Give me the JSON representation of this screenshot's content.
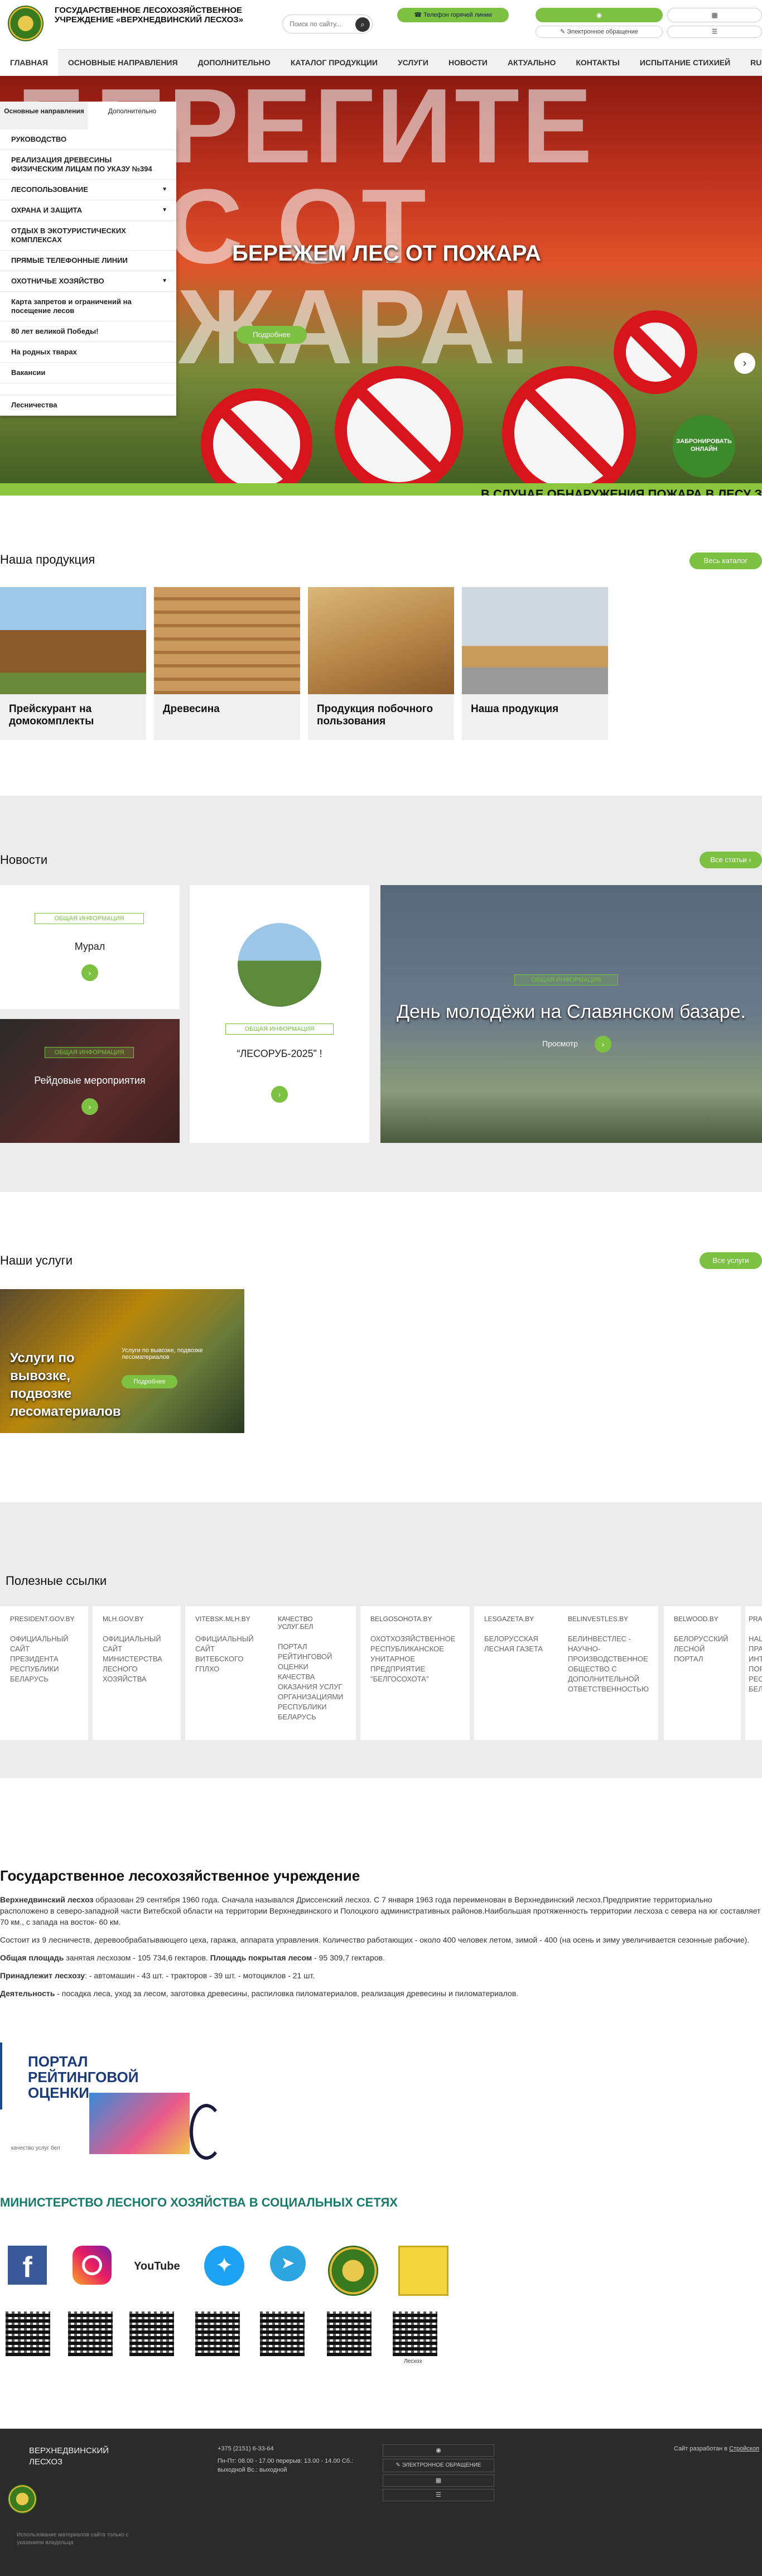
{
  "header": {
    "org_name": "ГОСУДАРСТВЕННОЕ ЛЕСОХОЗЯЙСТВЕННОЕ УЧРЕЖДЕНИЕ «ВЕРХНЕДВИНСКИЙ ЛЕСХОЗ»",
    "search_placeholder": "Поиск по сайту...",
    "hotline": "Телефон горячей линии",
    "eappeal": "Электронное обращение"
  },
  "nav": [
    "ГЛАВНАЯ",
    "ОСНОВНЫЕ НАПРАВЛЕНИЯ",
    "ДОПОЛНИТЕЛЬНО",
    "КАТАЛОГ ПРОДУКЦИИ",
    "УСЛУГИ",
    "НОВОСТИ",
    "АКТУАЛЬНО",
    "КОНТАКТЫ",
    "ИСПЫТАНИЕ СТИХИЕЙ",
    "RU"
  ],
  "dropdown": {
    "tabs": [
      "Основные направления",
      "Дополнительно"
    ],
    "items": [
      "РУКОВОДСТВО",
      "РЕАЛИЗАЦИЯ ДРЕВЕСИНЫ ФИЗИЧЕСКИМ ЛИЦАМ ПО УКАЗУ №394",
      "ЛЕСОПОЛЬЗОВАНИЕ",
      "ОХРАНА И ЗАЩИТА",
      "ОТДЫХ В ЭКОТУРИСТИЧЕСКИХ КОМПЛЕКСАХ",
      "ПРЯМЫЕ ТЕЛЕФОННЫЕ ЛИНИИ",
      "ОХОТНИЧЬЕ ХОЗЯЙСТВО",
      "Карта запретов и ограничений на посещение лесов",
      "80 лет великой Победы!",
      "На родных тварах",
      "Вакансии",
      "Лесничества"
    ]
  },
  "hero": {
    "big_text": "БЕРЕГИТЕ ЛЕС ОТ ПОЖАРА!",
    "title": "БЕРЕЖЕМ ЛЕС ОТ ПОЖАРА",
    "button": "Подробнее",
    "book": "ЗАБРОНИРОВАТЬ ОНЛАЙН",
    "ticker": "В СЛУЧАЕ ОБНАРУЖЕНИЯ ПОЖАРА В ЛЕСУ З"
  },
  "products": {
    "title": "Наша продукция",
    "button": "Весь каталог",
    "items": [
      "Прейскурант на домокомплекты",
      "Древесина",
      "Продукция побочного пользования",
      "Наша продукция"
    ]
  },
  "news": {
    "title": "Новости",
    "button": "Все статьи ›",
    "tag": "ОБЩАЯ ИНФОРМАЦИЯ",
    "items": [
      "Мурал",
      "Рейдовые мероприятия",
      "“ЛЕСОРУБ-2025” !",
      "День молодёжи на Славянском базаре."
    ],
    "view": "Просмотр"
  },
  "services": {
    "title": "Наши услуги",
    "button": "Все услуги",
    "card_title": "Услуги по вывозке, подвозке лесоматериалов",
    "card_small": "Услуги по вывозке, подвозке лесоматериалов",
    "card_btn": "Подробнее"
  },
  "links": {
    "title": "Полезные ссылки",
    "items": [
      {
        "dom": "PRESIDENT.GOV.BY",
        "desc": "ОФИЦИАЛЬНЫЙ САЙТ ПРЕЗИДЕНТА РЕСПУБЛИКИ БЕЛАРУСЬ"
      },
      {
        "dom": "MLH.GOV.BY",
        "desc": "ОФИЦИАЛЬНЫЙ САЙТ МИНИСТЕРСТВА ЛЕСНОГО ХОЗЯЙСТВА"
      },
      {
        "dom": "VITEBSK.MLH.BY",
        "desc": "ОФИЦИАЛЬНЫЙ САЙТ ВИТЕБСКОГО ГПЛХО"
      },
      {
        "dom": "КАЧЕСТВО УСЛУГ.БЕЛ",
        "desc": "ПОРТАЛ РЕЙТИНГОВОЙ ОЦЕНКИ КАЧЕСТВА ОКАЗАНИЯ УСЛУГ ОРГАНИЗАЦИЯМИ РЕСПУБЛИКИ БЕЛАРУСЬ"
      },
      {
        "dom": "BELGOSOHOTA.BY",
        "desc": "ОХОТХОЗЯЙСТВЕННОЕ РЕСПУБЛИКАНСКОЕ УНИТАРНОЕ ПРЕДПРИЯТИЕ \"БЕЛГОСОХОТА\""
      },
      {
        "dom": "LESGAZETA.BY",
        "desc": "БЕЛОРУССКАЯ ЛЕСНАЯ ГАЗЕТА"
      },
      {
        "dom": "BELINVESTLES.BY",
        "desc": "БЕЛИНВЕСТЛЕС - НАУЧНО-ПРОИЗВОДСТВЕННОЕ ОБЩЕСТВО С ДОПОЛНИТЕЛЬНОЙ ОТВЕТСТВЕННОСТЬЮ"
      },
      {
        "dom": "BELWOOD.BY",
        "desc": "БЕЛОРУССКИЙ ЛЕСНОЙ ПОРТАЛ"
      },
      {
        "dom": "PRAVO.BY",
        "desc": "НАЦИОНАЛЬНЫЙ ПРАВОВОЙ ИНТЕРНЕТ-ПОРТАЛ РЕСПУБЛИКИ БЕЛАРУСЬ"
      }
    ]
  },
  "about": {
    "title": "Государственное лесохозяйственное учреждение",
    "p1_bold": "Верхнедвинский лесхоз",
    "p1": " образован 29 сентября 1960 года. Сначала назывался Дриссенский лесхоз. С 7 января 1963 года переименован в Верхнедвинский лесхоз.Предприятие территориально расположено в северо-западной части Витебской области на территории Верхнедвинского и Полоцкого административных районов.Наибольшая протяженность территории лесхоза с севера на юг составляет 70 км., с запада на восток- 60 км.",
    "p2": "Состоит из 9 лесничеств, деревообрабатывающего цеха, гаража, аппарата управления. Количество работающих - около 400 человек летом, зимой - 400 (на осень и зиму увеличивается сезонные рабочие).",
    "p3_b1": "Общая площадь",
    "p3_t1": " занятая лесхозом - 105 734,6 гектаров. ",
    "p3_b2": "Площадь покрытая лесом",
    "p3_t2": " - 95 309,7 гектаров.",
    "p4_b": "Принадлежит лесхозу",
    "p4": ": - автомашин - 43 шт. - тракторов - 39 шт. - мотоциклов - 21 шт.",
    "p5_b": "Деятельность",
    "p5": " - посадка леса, уход за лесом, заготовка древесины, распиловка пиломатериалов, реализация древесины и пиломатериалов.",
    "portal_title": "ПОРТАЛ РЕЙТИНГОВОЙ ОЦЕНКИ",
    "portal_sub": "качество услуг бел"
  },
  "social": {
    "title": "МИНИСТЕРСТВО ЛЕСНОГО ХОЗЯЙСТВА В СОЦИАЛЬНЫХ СЕТЯХ",
    "youtube": "YouTube",
    "qr_caption": "Лесхоз"
  },
  "footer": {
    "org": "ВЕРХНЕДВИНСКИЙ ЛЕСХОЗ",
    "phone": "+375 (2151) 6-33-64",
    "hours": "Пн-Пт: 08.00 - 17.00 перерыв: 13.00 - 14.00 Сб.: выходной Вс.: выходной",
    "eappeal": "ЭЛЕКТРОННОЕ ОБРАЩЕНИЕ",
    "dev": "Сайт разработан в",
    "dev_link": "Стройскоп",
    "copy": "Использование материалов сайта только с указанием владельца"
  },
  "colors": {
    "accent": "#7cc142",
    "dark": "#2b2b2b",
    "text": "#222222"
  }
}
